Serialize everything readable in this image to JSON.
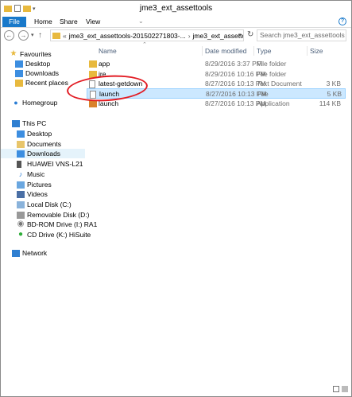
{
  "window": {
    "title": "jme3_ext_assettools"
  },
  "ribbon": {
    "tabs": [
      "File",
      "Home",
      "Share",
      "View"
    ]
  },
  "address": {
    "path": [
      "«",
      "jme3_ext_assettools-201502271803-...",
      "jme3_ext_assettools"
    ],
    "search_placeholder": "Search jme3_ext_assettools"
  },
  "nav": {
    "favourites": {
      "label": "Favourites",
      "items": [
        "Desktop",
        "Downloads",
        "Recent places"
      ]
    },
    "homegroup": "Homegroup",
    "thispc": {
      "label": "This PC",
      "items": [
        "Desktop",
        "Documents",
        "Downloads",
        "HUAWEI VNS-L21",
        "Music",
        "Pictures",
        "Videos",
        "Local Disk (C:)",
        "Removable Disk (D:)",
        "BD-ROM Drive (I:) RA1",
        "CD Drive (K:) HiSuite"
      ]
    },
    "network": "Network"
  },
  "columns": {
    "name": "Name",
    "date": "Date modified",
    "type": "Type",
    "size": "Size"
  },
  "files": [
    {
      "name": "app",
      "date": "8/29/2016 3:37 PM",
      "type": "File folder",
      "size": "",
      "icon": "folder-icon"
    },
    {
      "name": "jre",
      "date": "8/29/2016 10:16 PM",
      "type": "File folder",
      "size": "",
      "icon": "folder-icon"
    },
    {
      "name": "latest-getdown",
      "date": "8/27/2016 10:13 PM",
      "type": "Text Document",
      "size": "3 KB",
      "icon": "text-document-icon"
    },
    {
      "name": "launch",
      "date": "8/27/2016 10:13 PM",
      "type": "File",
      "size": "5 KB",
      "icon": "file-icon"
    },
    {
      "name": "launch",
      "date": "8/27/2016 10:13 PM",
      "type": "Application",
      "size": "114 KB",
      "icon": "application-icon"
    }
  ],
  "selected_index": 3,
  "colors": {
    "accent": "#1979ca",
    "selection": "#cce8ff",
    "annotation": "#e21b23",
    "folder": "#e8b93e"
  }
}
